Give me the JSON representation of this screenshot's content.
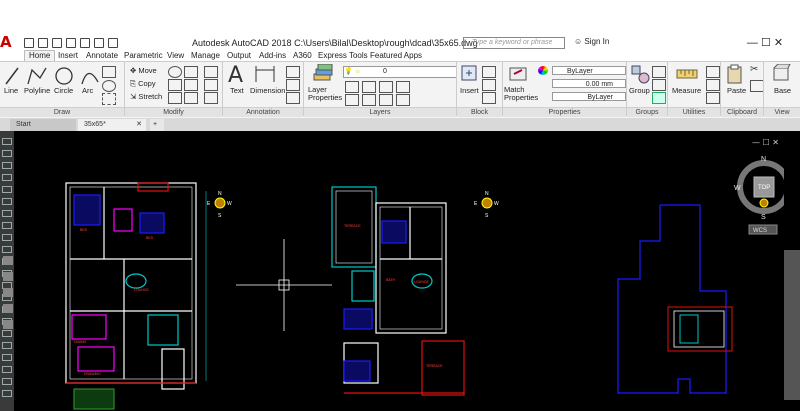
{
  "app": {
    "logo": "A",
    "title": "Autodesk AutoCAD 2018    C:\\Users\\Bilal\\Desktop\\rough\\dcad\\35x65.dwg",
    "search_placeholder": "Type a keyword or phrase",
    "signin": "Sign In"
  },
  "ribbon_tabs": [
    "Home",
    "Insert",
    "Annotate",
    "Parametric",
    "View",
    "Manage",
    "Output",
    "Add-ins",
    "A360",
    "Express Tools",
    "Featured Apps"
  ],
  "draw": {
    "line": "Line",
    "polyline": "Polyline",
    "circle": "Circle",
    "arc": "Arc",
    "panel": "Draw"
  },
  "modify": {
    "move": "Move",
    "copy": "Copy",
    "stretch": "Stretch",
    "panel": "Modify"
  },
  "annotation": {
    "text": "Text",
    "dimension": "Dimension",
    "panel": "Annotation"
  },
  "layers": {
    "layer_properties": "Layer Properties",
    "current_layer": "0",
    "panel": "Layers"
  },
  "block": {
    "insert": "Insert",
    "panel": "Block"
  },
  "properties": {
    "match": "Match Properties",
    "color": "ByLayer",
    "lineweight": "0.00 mm",
    "linetype": "ByLayer",
    "panel": "Properties"
  },
  "groups": {
    "group": "Group",
    "panel": "Groups"
  },
  "utilities": {
    "measure": "Measure",
    "panel": "Utilities"
  },
  "clipboard": {
    "paste": "Paste",
    "panel": "Clipboard"
  },
  "view": {
    "base": "Base",
    "panel": "View"
  },
  "file_tabs": {
    "start": "Start",
    "active": "35x65*"
  },
  "viewcube": {
    "n": "N",
    "s": "S",
    "e": "E",
    "w": "W",
    "top": "TOP",
    "wcs": "WCS"
  },
  "compass": {
    "n": "N",
    "s": "S",
    "e": "E",
    "w": "W"
  },
  "canvas": {
    "window_controls": "— ☐ ✕"
  },
  "colors": {
    "bg": "#000000",
    "wall": "#ffffff",
    "magenta": "#ff00ff",
    "cyan": "#00c8c8",
    "red": "#e01010",
    "blue": "#1a1aff",
    "yellow": "#e8e000"
  }
}
